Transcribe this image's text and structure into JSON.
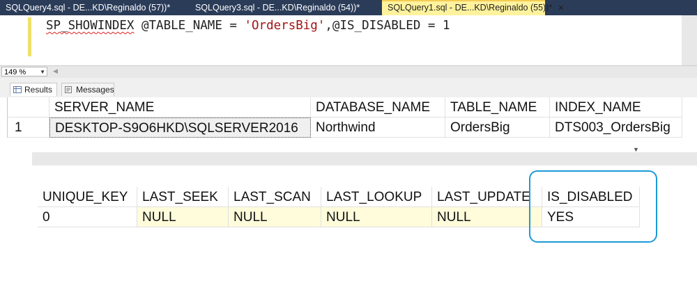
{
  "tabs": [
    {
      "label": "SQLQuery4.sql - DE...KD\\Reginaldo (57))*",
      "close": ""
    },
    {
      "label": "SQLQuery3.sql - DE...KD\\Reginaldo (54))*",
      "close": ""
    },
    {
      "label": "SQLQuery1.sql - DE...KD\\Reginaldo (55))*",
      "close": "✕",
      "active": true
    }
  ],
  "editor": {
    "proc": "SP_SHOWINDEX",
    "code_mid": " @TABLE_NAME = ",
    "string_lit": "'OrdersBig'",
    "code_end": ",@IS_DISABLED = 1"
  },
  "zoom": {
    "value": "149 %"
  },
  "result_tabs": {
    "results": "Results",
    "messages": "Messages"
  },
  "grid1": {
    "columns": [
      "SERVER_NAME",
      "DATABASE_NAME",
      "TABLE_NAME",
      "INDEX_NAME"
    ],
    "row_number": "1",
    "row": [
      "DESKTOP-S9O6HKD\\SQLSERVER2016",
      "Northwind",
      "OrdersBig",
      "DTS003_OrdersBig"
    ]
  },
  "grid2": {
    "columns": [
      "UNIQUE_KEY",
      "LAST_SEEK",
      "LAST_SCAN",
      "LAST_LOOKUP",
      "LAST_UPDATE",
      "IS_DISABLED"
    ],
    "row": [
      "0",
      "NULL",
      "NULL",
      "NULL",
      "NULL",
      "YES"
    ]
  },
  "colors": {
    "highlight": "#1a9ad8",
    "active_tab": "#fff29d",
    "tab_strip": "#2b3c59"
  }
}
